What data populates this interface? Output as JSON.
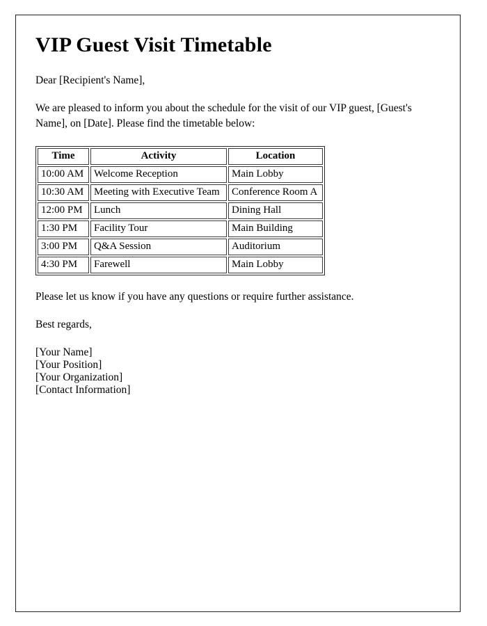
{
  "document": {
    "title": "VIP Guest Visit Timetable",
    "salutation": "Dear [Recipient's Name],",
    "intro_paragraph": "We are pleased to inform you about the schedule for the visit of our VIP guest, [Guest's Name], on [Date]. Please find the timetable below:",
    "closing_paragraph": "Please let us know if you have any questions or require further assistance.",
    "regards": "Best regards,",
    "signature": {
      "name": "[Your Name]",
      "position": "[Your Position]",
      "organization": "[Your Organization]",
      "contact": "[Contact Information]"
    }
  },
  "table": {
    "headers": {
      "time": "Time",
      "activity": "Activity",
      "location": "Location"
    },
    "rows": [
      {
        "time": "10:00 AM",
        "activity": "Welcome Reception",
        "location": "Main Lobby"
      },
      {
        "time": "10:30 AM",
        "activity": "Meeting with Executive Team",
        "location": "Conference Room A"
      },
      {
        "time": "12:00 PM",
        "activity": "Lunch",
        "location": "Dining Hall"
      },
      {
        "time": "1:30 PM",
        "activity": "Facility Tour",
        "location": "Main Building"
      },
      {
        "time": "3:00 PM",
        "activity": "Q&A Session",
        "location": "Auditorium"
      },
      {
        "time": "4:30 PM",
        "activity": "Farewell",
        "location": "Main Lobby"
      }
    ]
  },
  "colors": {
    "page_background": "#ffffff",
    "text": "#000000",
    "page_border": "#222222",
    "table_border": "#3a3a3a"
  }
}
